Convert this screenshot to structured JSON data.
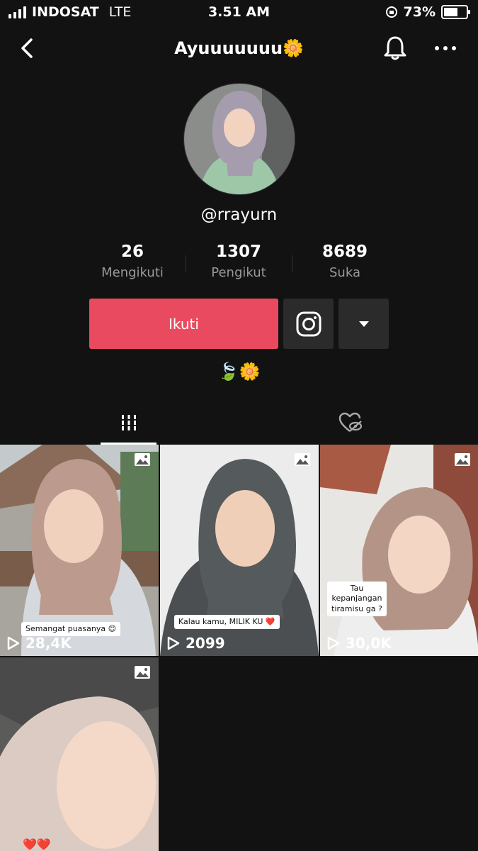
{
  "status_bar": {
    "carrier": "INDOSAT",
    "network": "LTE",
    "time": "3.51 AM",
    "battery_percent": "73%",
    "battery_level": 0.73
  },
  "nav": {
    "title": "Ayuuuuuuu🌼",
    "back_icon": "chevron-left-icon",
    "notification_icon": "bell-icon",
    "more_icon": "more-horizontal-icon"
  },
  "profile": {
    "username": "@rrayurn",
    "stats": [
      {
        "value": "26",
        "label": "Mengikuti"
      },
      {
        "value": "1307",
        "label": "Pengikut"
      },
      {
        "value": "8689",
        "label": "Suka"
      }
    ],
    "follow_label": "Ikuti",
    "bio": "🍃🌼"
  },
  "colors": {
    "background": "#121212",
    "follow_button": "#ea4a5f",
    "secondary_button": "#2b2b2b"
  },
  "tabs": {
    "videos_icon": "grid-icon",
    "liked_icon": "heart-hidden-icon"
  },
  "posts": [
    {
      "caption": "Semangat puasanya 😊",
      "views": "28,4K"
    },
    {
      "caption": "Kalau kamu, MILIK KU ❤️",
      "views": "2099"
    },
    {
      "caption": "Tau kepanjangan tiramisu ga ?",
      "views": "30,0K"
    },
    {
      "caption": "❤️❤️",
      "views": ""
    }
  ]
}
